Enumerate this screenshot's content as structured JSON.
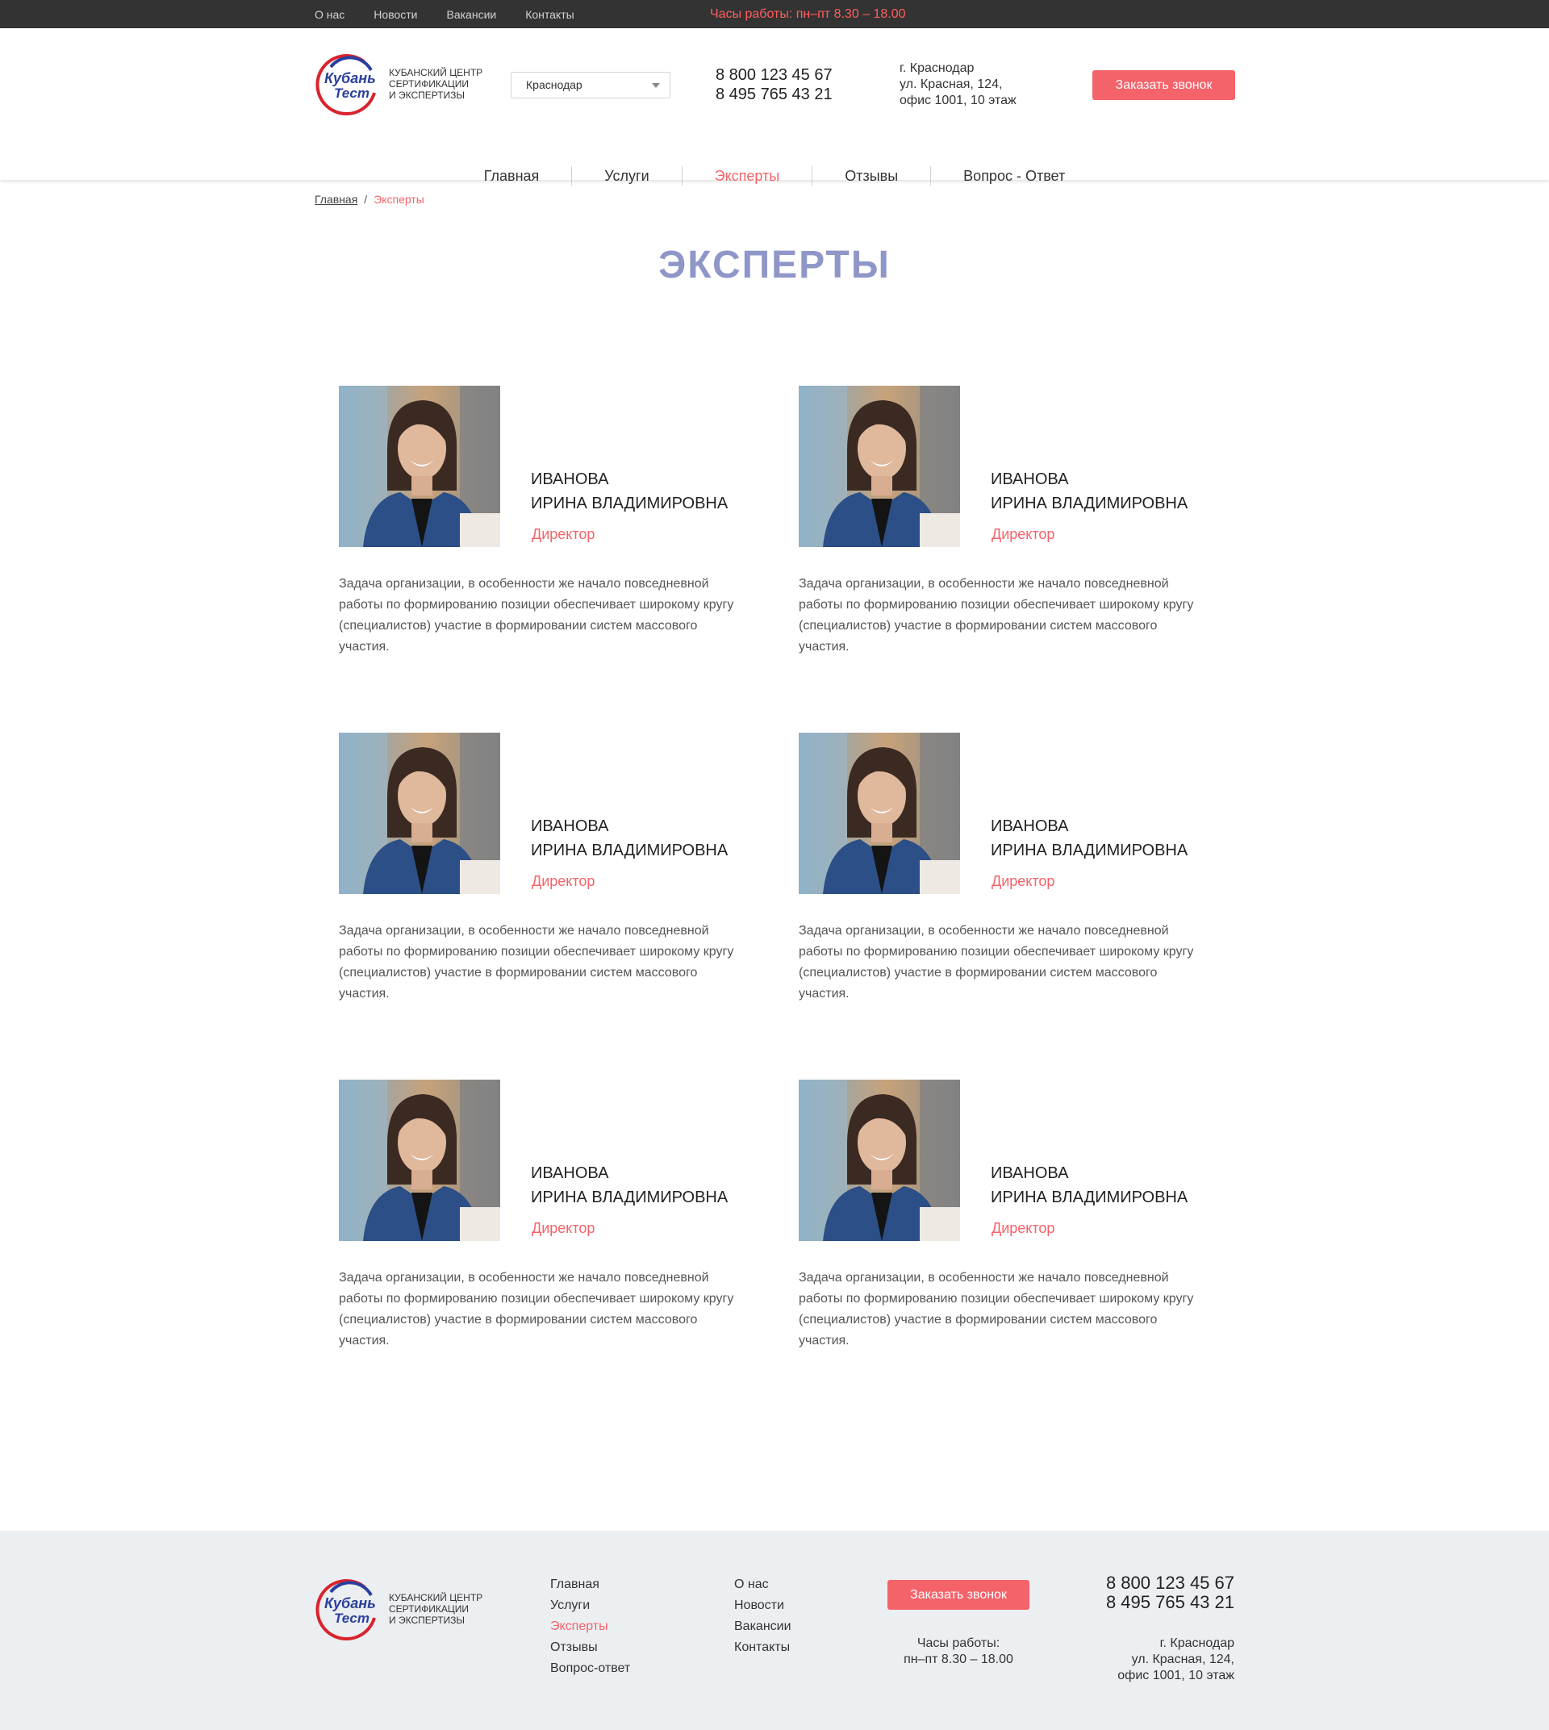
{
  "topbar": {
    "links": [
      "О нас",
      "Новости",
      "Вакансии",
      "Контакты"
    ],
    "hours": "Часы работы: пн–пт 8.30 – 18.00"
  },
  "header": {
    "logo_word1": "Кубань",
    "logo_word2": "Тест",
    "logo_lines": [
      "Кубанский центр",
      "сертификации",
      "и экспертизы"
    ],
    "city": "Краснодар",
    "phones": [
      "8 800 123 45 67",
      "8 495 765 43 21"
    ],
    "address_lines": [
      "г. Краснодар",
      "ул. Красная, 124,",
      "офис 1001, 10 этаж"
    ],
    "callback_label": "Заказать звонок"
  },
  "nav": {
    "items": [
      "Главная",
      "Услуги",
      "Эксперты",
      "Отзывы",
      "Вопрос - Ответ"
    ],
    "active": "Эксперты"
  },
  "breadcrumb": {
    "home": "Главная",
    "separator": "/",
    "current": "Эксперты"
  },
  "page_title": "ЭКСПЕРТЫ",
  "experts": [
    {
      "surname": "Иванова",
      "given": "Ирина Владимировна",
      "role": "Директор",
      "text": "Задача организации, в особенности же начало повседневной работы по формированию позиции обеспечивает широкому кругу (специалистов) участие в формировании систем массового участия."
    },
    {
      "surname": "Иванова",
      "given": "Ирина Владимировна",
      "role": "Директор",
      "text": "Задача организации, в особенности же начало повседневной работы по формированию позиции обеспечивает широкому кругу (специалистов) участие в формировании систем массового участия."
    },
    {
      "surname": "Иванова",
      "given": "Ирина Владимировна",
      "role": "Директор",
      "text": "Задача организации, в особенности же начало повседневной работы по формированию позиции обеспечивает широкому кругу (специалистов) участие в формировании систем массового участия."
    },
    {
      "surname": "Иванова",
      "given": "Ирина Владимировна",
      "role": "Директор",
      "text": "Задача организации, в особенности же начало повседневной работы по формированию позиции обеспечивает широкому кругу (специалистов) участие в формировании систем массового участия."
    },
    {
      "surname": "Иванова",
      "given": "Ирина Владимировна",
      "role": "Директор",
      "text": "Задача организации, в особенности же начало повседневной работы по формированию позиции обеспечивает широкому кругу (специалистов) участие в формировании систем массового участия."
    },
    {
      "surname": "Иванова",
      "given": "Ирина Владимировна",
      "role": "Директор",
      "text": "Задача организации, в особенности же начало повседневной работы по формированию позиции обеспечивает широкому кругу (специалистов) участие в формировании систем массового участия."
    }
  ],
  "footer": {
    "col1": [
      "Главная",
      "Услуги",
      "Эксперты",
      "Отзывы",
      "Вопрос-ответ"
    ],
    "col1_active": "Эксперты",
    "col2": [
      "О нас",
      "Новости",
      "Вакансии",
      "Контакты"
    ],
    "callback_label": "Заказать звонок",
    "hours_lines": [
      "Часы работы:",
      "пн–пт 8.30 – 18.00"
    ],
    "phones": [
      "8 800 123 45 67",
      "8 495 765 43 21"
    ],
    "address_lines": [
      "г. Краснодар",
      "ул. Красная, 124,",
      "офис 1001, 10 этаж"
    ]
  },
  "colors": {
    "accent": "#f5636a",
    "title": "#8f96c8",
    "topbar": "#333333",
    "footer_bg": "#eceff1",
    "logo_blue": "#2b3f9e",
    "logo_red": "#d9232d"
  },
  "icons": [
    "dropdown-arrow-icon",
    "logo-mark-icon",
    "expert-photo-image"
  ]
}
